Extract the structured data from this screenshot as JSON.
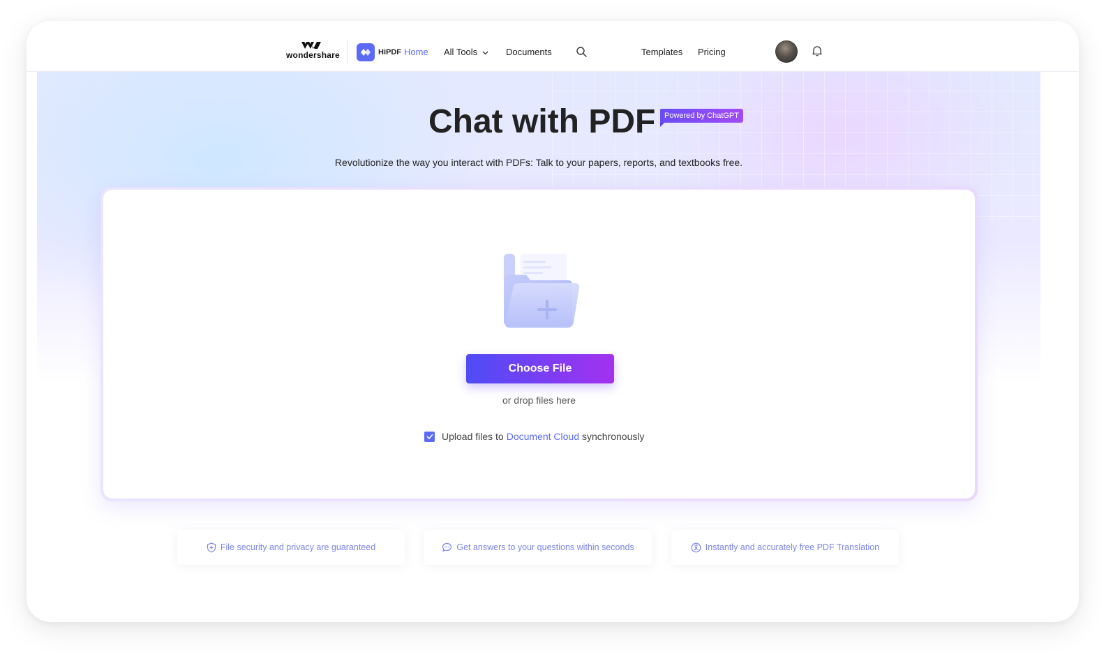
{
  "header": {
    "brand_text": "wondershare",
    "product_name": "HiPDF",
    "nav": {
      "home": "Home",
      "all_tools": "All Tools",
      "documents": "Documents",
      "templates": "Templates",
      "pricing": "Pricing"
    }
  },
  "hero": {
    "title": "Chat with PDF",
    "badge": "Powered by ChatGPT",
    "subtitle": "Revolutionize the way you interact with PDFs: Talk to your papers, reports, and textbooks free."
  },
  "upload": {
    "choose_button": "Choose File",
    "drop_text": "or drop files here",
    "sync_prefix": "Upload files to",
    "sync_link": "Document Cloud",
    "sync_suffix": "synchronously",
    "sync_checked": true
  },
  "features": [
    {
      "icon": "shield-icon",
      "text": "File security and privacy are guaranteed"
    },
    {
      "icon": "chat-bubble-icon",
      "text": "Get answers to your questions within seconds"
    },
    {
      "icon": "translate-icon",
      "text": "Instantly and accurately free PDF Translation"
    }
  ],
  "colors": {
    "accent": "#5b6bf7",
    "button_gradient_start": "#4e4cf6",
    "button_gradient_end": "#a331f0",
    "feature_text": "#7b85e6"
  }
}
